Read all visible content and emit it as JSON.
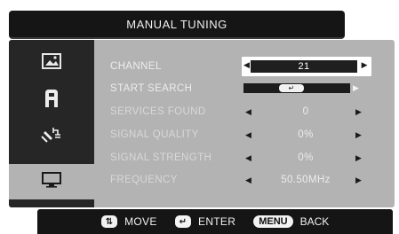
{
  "title": "MANUAL TUNING",
  "sidebar": [
    {
      "icon": "picture-icon",
      "glyph": "🖼"
    },
    {
      "icon": "sound-icon",
      "glyph": "Ä"
    },
    {
      "icon": "satellite-icon",
      "glyph": "📡"
    },
    {
      "icon": "monitor-icon",
      "glyph": "▭"
    }
  ],
  "rows": {
    "channel": {
      "label": "CHANNEL",
      "value": "21"
    },
    "start_search": {
      "label": "START SEARCH",
      "value": "↵"
    },
    "services_found": {
      "label": "SERVICES FOUND",
      "value": "0"
    },
    "signal_quality": {
      "label": "SIGNAL QUALITY",
      "value": "0%"
    },
    "signal_strength": {
      "label": "SIGNAL STRENGTH",
      "value": "0%"
    },
    "frequency": {
      "label": "FREQUENCY",
      "value": "50.50MHz"
    }
  },
  "arrows": {
    "left": "◀",
    "right": "▶"
  },
  "footer": {
    "move_key": "⇅",
    "move_label": "MOVE",
    "enter_key": "↵",
    "enter_label": "ENTER",
    "menu_key": "MENU",
    "back_label": "BACK"
  }
}
